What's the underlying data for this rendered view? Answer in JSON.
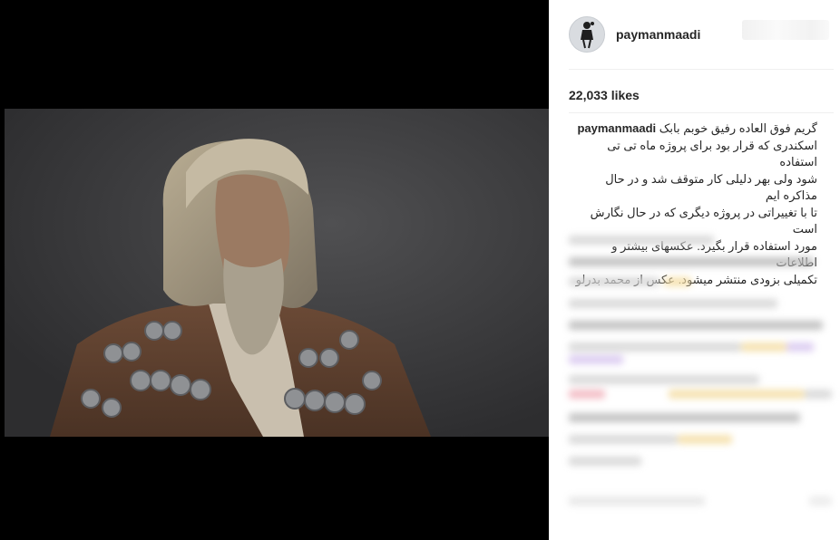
{
  "post": {
    "username": "paymanmaadi",
    "likes": "22,033 likes",
    "caption": {
      "author": "paymanmaadi",
      "lines": [
        "گریم فوق العاده رفیق خوبم بابک",
        "اسکندری که قرار بود برای پروژه ماه تی تی استفاده",
        "شود ولی بهر دلیلی کار متوقف شد و در حال مذاکره ایم",
        "تا با تغییراتی در پروژه دیگری که در حال نگارش است",
        "مورد استفاده قرار بگیرد. عکسهای بیشتر و اطلاعات",
        "تکمیلی بزودی منتشر میشود. عکس از محمد بدرلو"
      ]
    },
    "icons": {
      "avatar": "profile-avatar-icon"
    }
  },
  "colors": {
    "text": "#262626",
    "divider": "#efefef",
    "media_bg": "#000000"
  }
}
